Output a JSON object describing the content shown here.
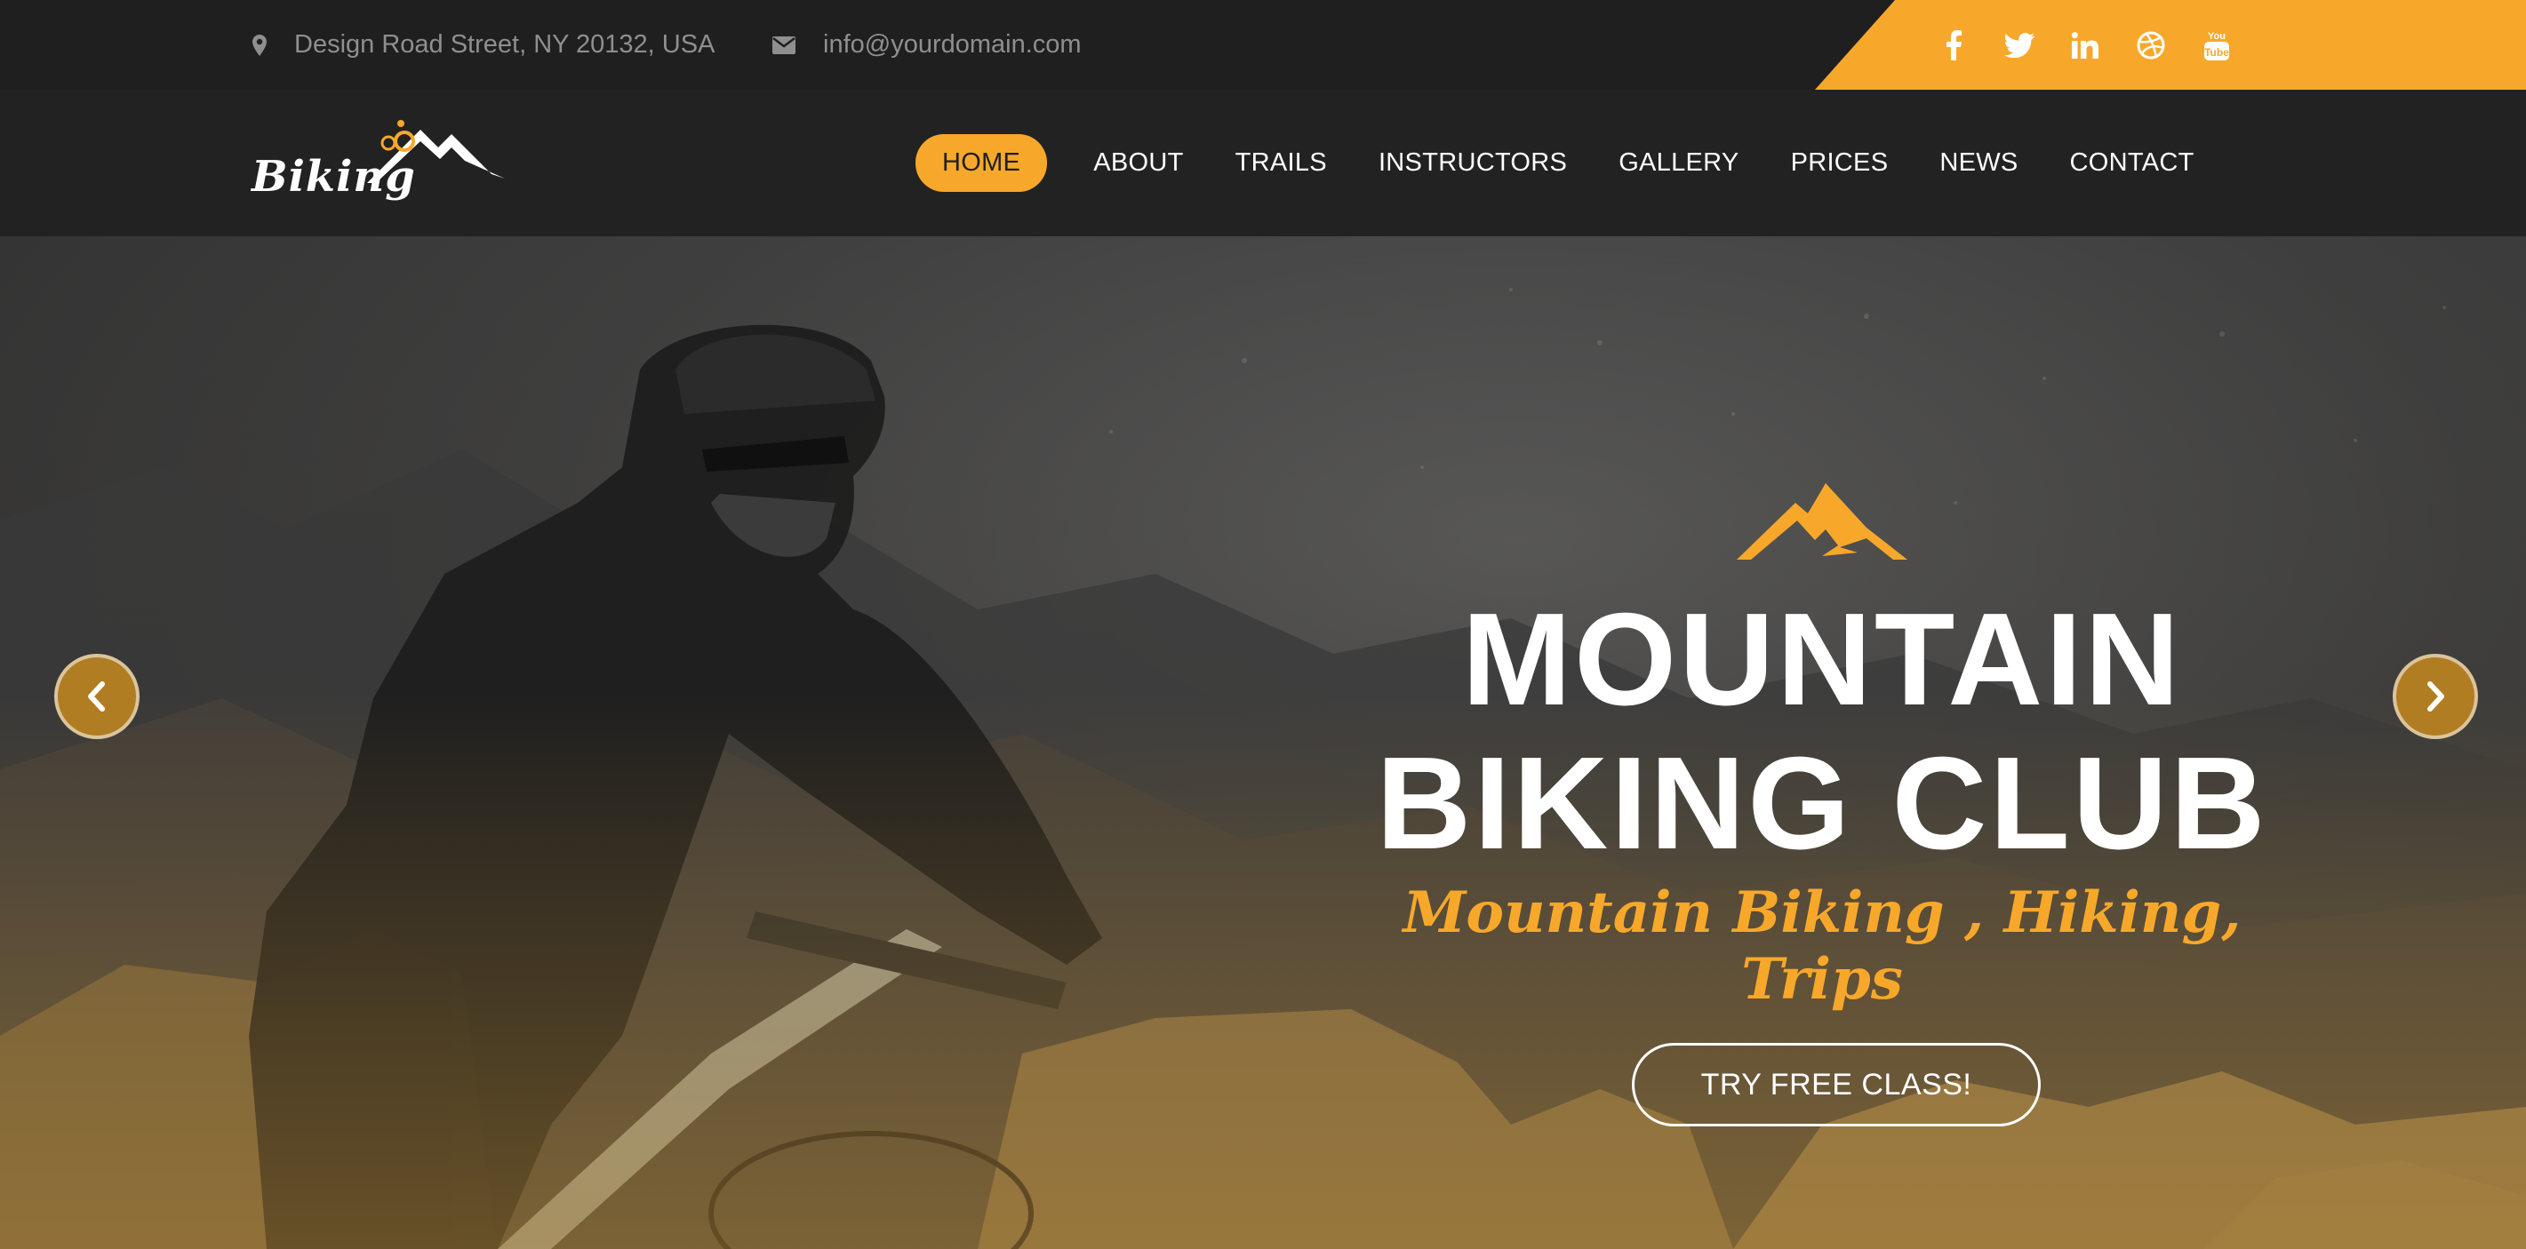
{
  "topbar": {
    "address": "Design Road Street, NY 20132, USA",
    "email": "info@yourdomain.com",
    "social": [
      "facebook-icon",
      "twitter-icon",
      "linkedin-icon",
      "dribbble-icon",
      "youtube-icon"
    ],
    "accent": "#f7a82b"
  },
  "logo": {
    "text": "Biking"
  },
  "nav": {
    "items": [
      {
        "label": "HOME",
        "active": true
      },
      {
        "label": "ABOUT"
      },
      {
        "label": "TRAILS"
      },
      {
        "label": "INSTRUCTORS"
      },
      {
        "label": "GALLERY"
      },
      {
        "label": "PRICES"
      },
      {
        "label": "NEWS"
      },
      {
        "label": "CONTACT"
      }
    ]
  },
  "hero": {
    "title_line1": "MOUNTAIN",
    "title_line2": "BIKING CLUB",
    "subtitle": "Mountain Biking , Hiking, Trips",
    "cta": "TRY FREE CLASS!"
  },
  "colors": {
    "accent": "#f7a82b",
    "dark": "#1f1f1f",
    "navbar": "#222222"
  }
}
